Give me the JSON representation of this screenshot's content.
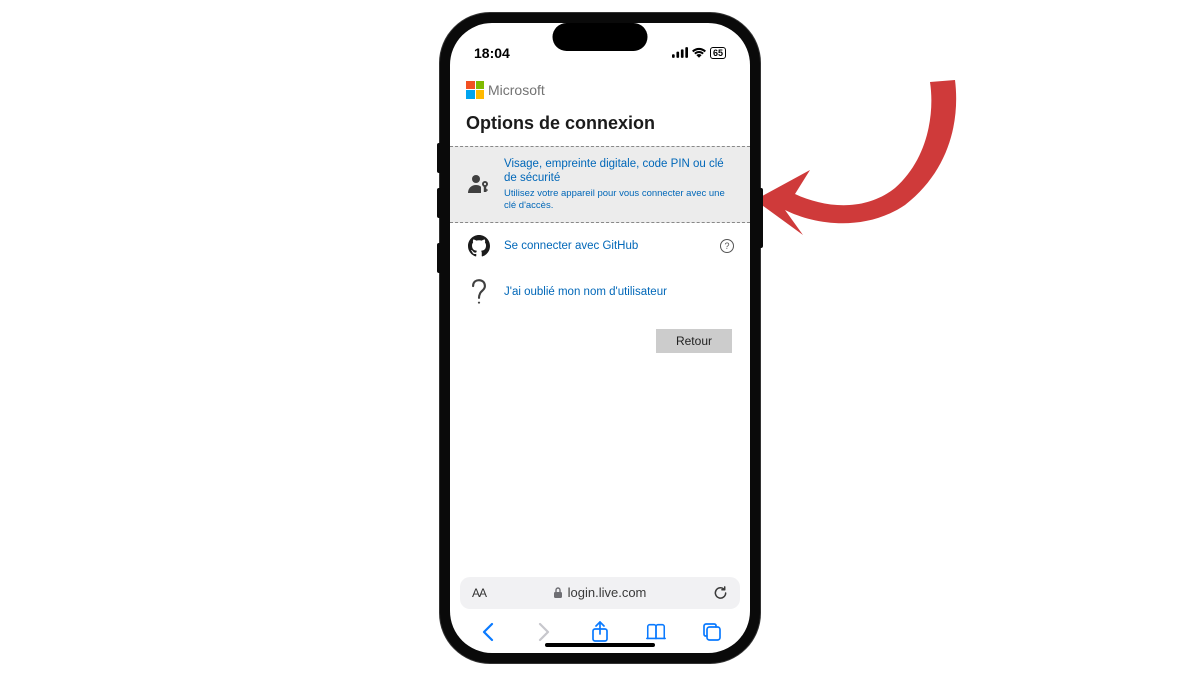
{
  "status": {
    "time": "18:04",
    "battery": "65"
  },
  "brand": "Microsoft",
  "page_title": "Options de connexion",
  "options": [
    {
      "title": "Visage, empreinte digitale, code PIN ou clé de sécurité",
      "subtitle": "Utilisez votre appareil pour vous connecter avec une clé d'accès."
    },
    {
      "title": "Se connecter avec GitHub"
    },
    {
      "title": "J'ai oublié mon nom d'utilisateur"
    }
  ],
  "back_label": "Retour",
  "browser": {
    "text_size": "AA",
    "url": "login.live.com"
  },
  "colors": {
    "arrow": "#cf3a3a",
    "link": "#0067b8",
    "ios_blue": "#0a7aff"
  }
}
